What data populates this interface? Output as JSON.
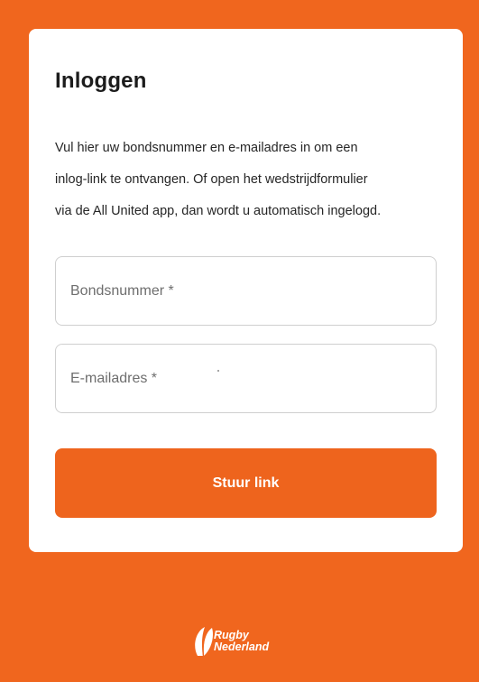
{
  "login": {
    "title": "Inloggen",
    "intro_lines": [
      "Vul hier uw bondsnummer en e-mailadres in om een",
      "inlog-link te ontvangen. Of open het wedstrijdformulier",
      "via de All United app, dan wordt u automatisch ingelogd."
    ],
    "fields": {
      "member_number": {
        "placeholder": "Bondsnummer *",
        "value": ""
      },
      "email": {
        "placeholder": "E-mailadres *",
        "value": ""
      }
    },
    "submit_label": "Stuur link"
  },
  "logo": {
    "icon": "rugby-ball-logo-icon",
    "line1": "Rugby",
    "line2": "Nederland"
  },
  "colors": {
    "background": "#f0661e",
    "button": "#ee641d",
    "card": "#ffffff"
  }
}
